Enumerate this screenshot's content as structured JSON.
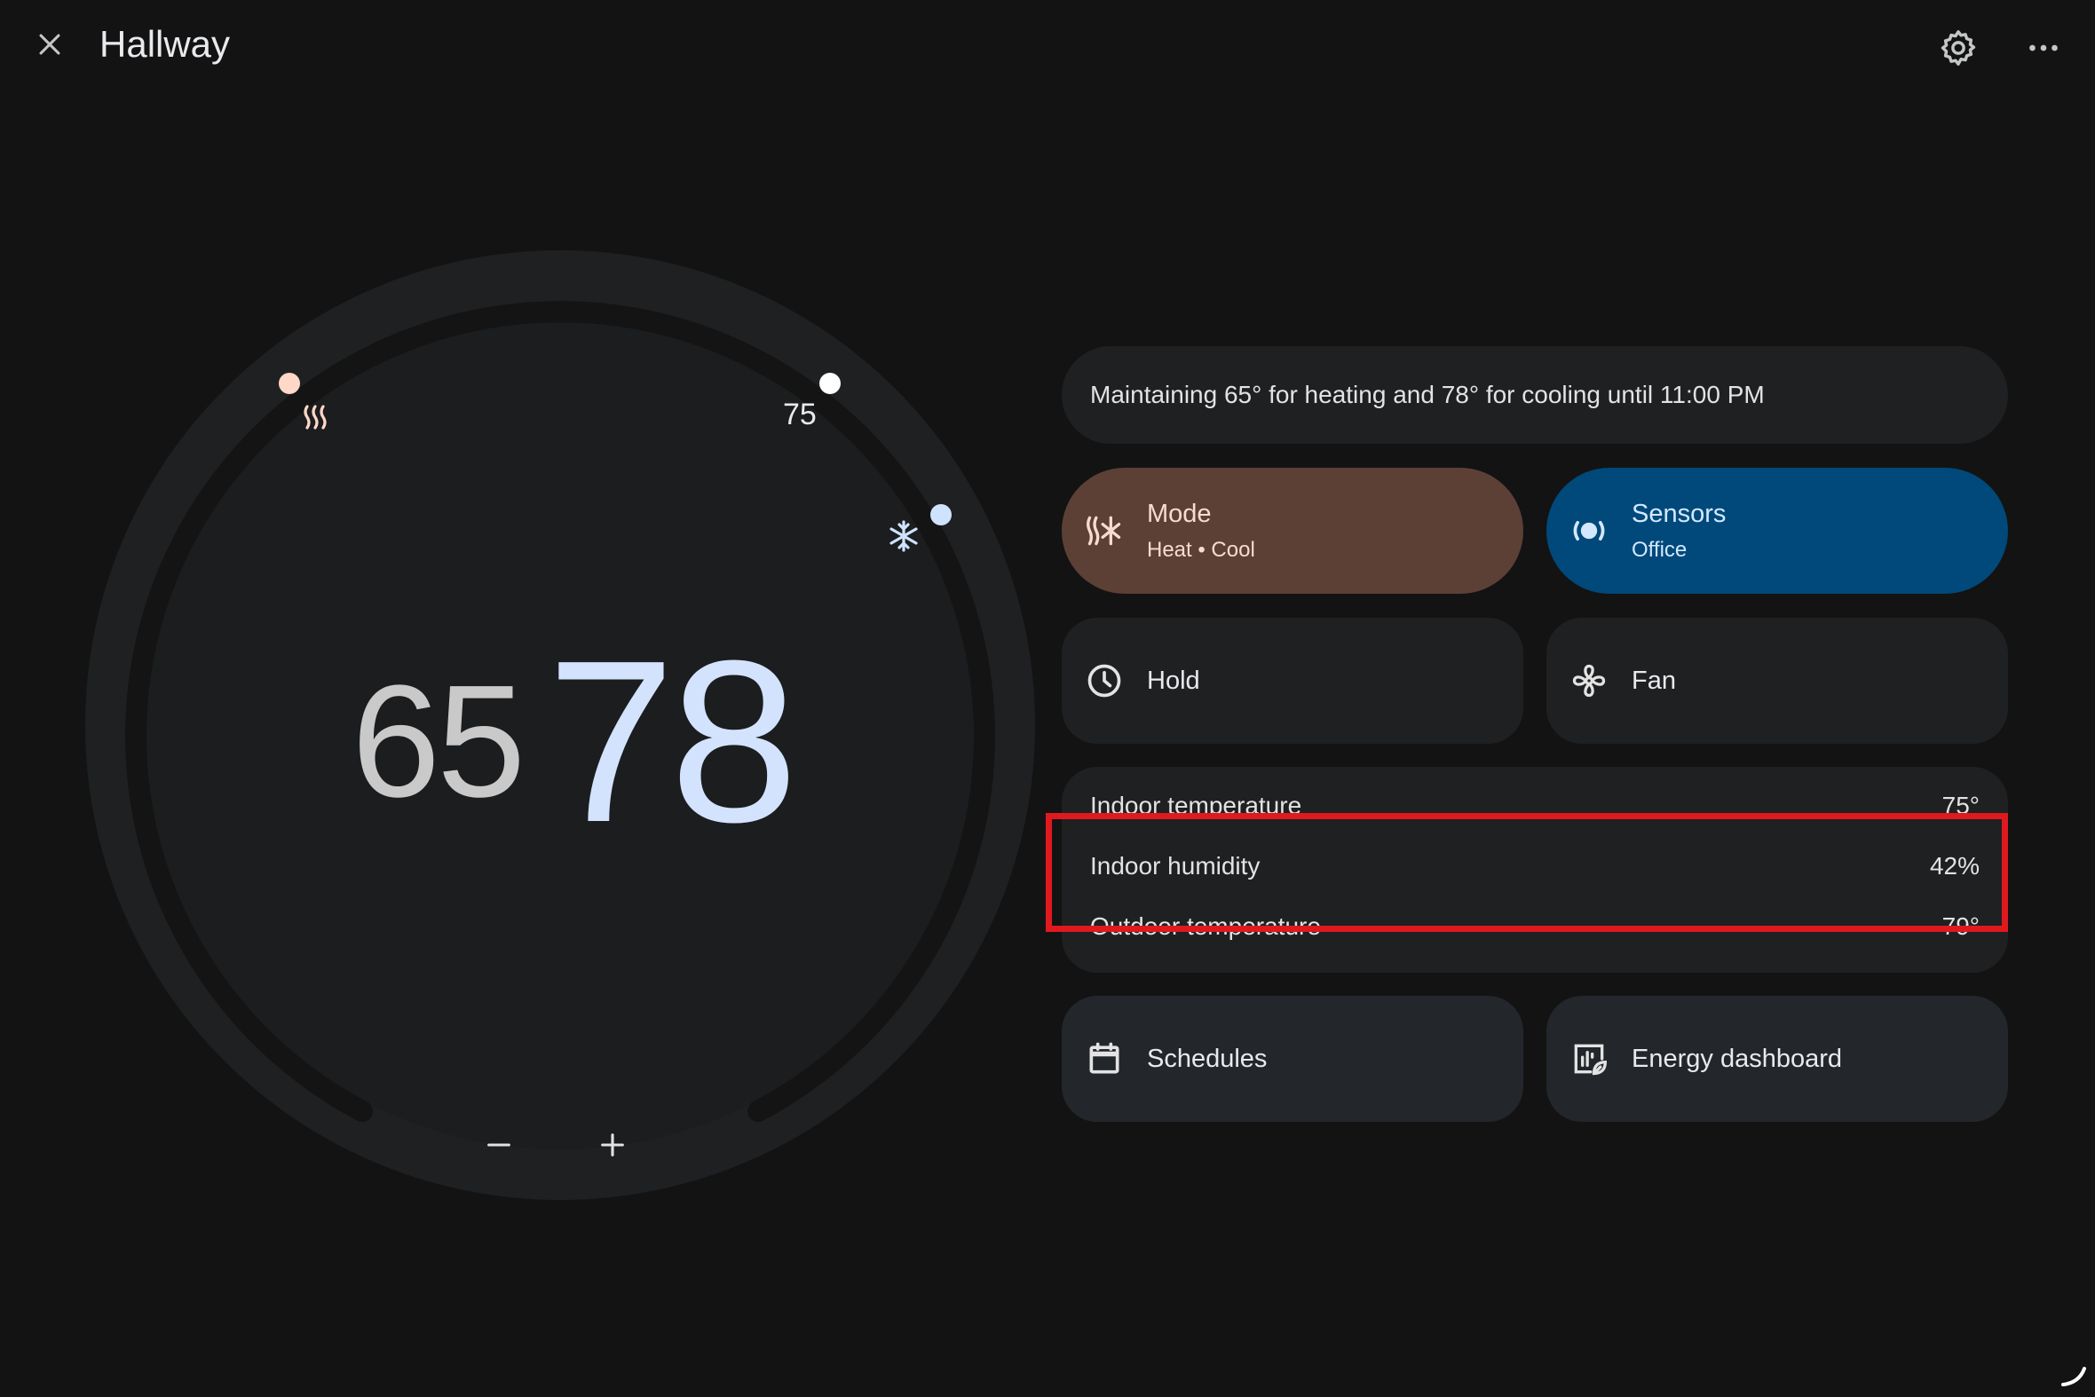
{
  "header": {
    "title": "Hallway",
    "close_icon": "close-icon",
    "settings_icon": "gear-icon",
    "more_icon": "more-horizontal-icon"
  },
  "dial": {
    "heat_setpoint": "65",
    "cool_setpoint": "78",
    "indoor_temp_marker": "75",
    "heat_color": "#ffd8c8",
    "cool_color": "#cfe3ff",
    "track_color": "#1f2022",
    "minus_label": "−",
    "plus_label": "+"
  },
  "status": {
    "text": "Maintaining 65° for heating and 78° for cooling until 11:00 PM"
  },
  "tiles": {
    "mode": {
      "label": "Mode",
      "sub": "Heat • Cool",
      "icon": "heat-cool-icon",
      "color": "#5c4036"
    },
    "sensors": {
      "label": "Sensors",
      "sub": "Office",
      "icon": "sensor-icon",
      "color": "#00497a"
    },
    "hold": {
      "label": "Hold",
      "icon": "clock-icon"
    },
    "fan": {
      "label": "Fan",
      "icon": "fan-icon"
    },
    "schedules": {
      "label": "Schedules",
      "icon": "calendar-icon"
    },
    "energy": {
      "label": "Energy dashboard",
      "icon": "energy-dashboard-icon"
    }
  },
  "info": {
    "rows": [
      {
        "label": "Indoor temperature",
        "value": "75°"
      },
      {
        "label": "Indoor humidity",
        "value": "42%"
      },
      {
        "label": "Outdoor temperature",
        "value": "79°"
      }
    ]
  },
  "highlight_color": "#e0191f"
}
